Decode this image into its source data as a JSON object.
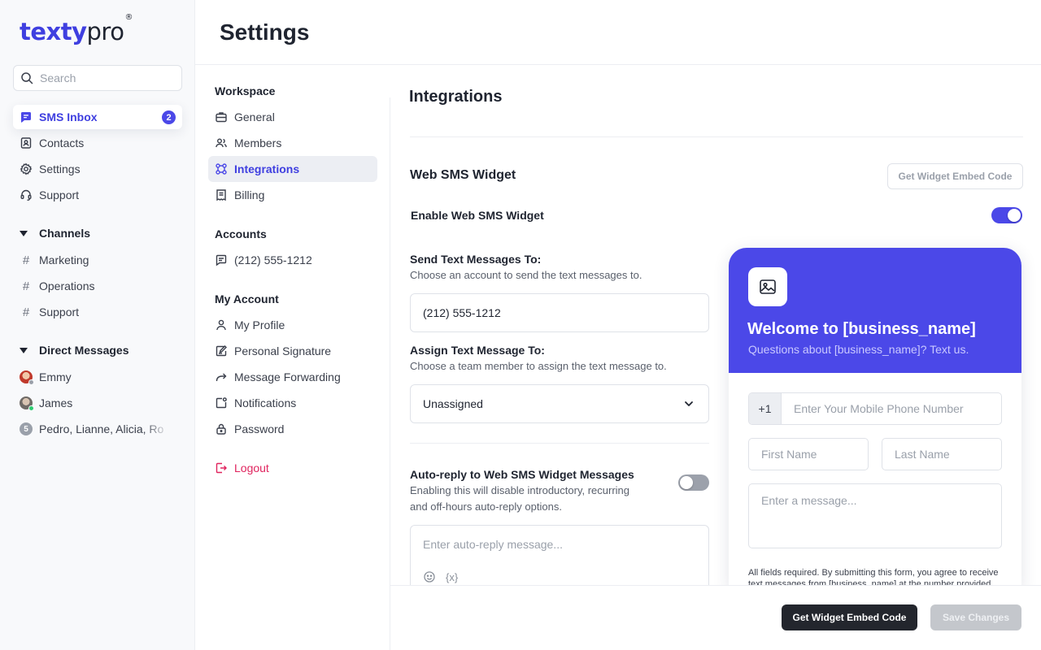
{
  "app": {
    "logo_main": "texty",
    "logo_accent": "pro",
    "logo_mark": "®"
  },
  "search": {
    "placeholder": "Search"
  },
  "sidebar": {
    "items": [
      {
        "label": "SMS Inbox",
        "icon": "chat-icon",
        "badge": "2",
        "active": true
      },
      {
        "label": "Contacts",
        "icon": "contacts-icon"
      },
      {
        "label": "Settings",
        "icon": "gear-icon"
      },
      {
        "label": "Support",
        "icon": "headset-icon"
      }
    ],
    "channels": {
      "heading": "Channels",
      "items": [
        "Marketing",
        "Operations",
        "Support"
      ]
    },
    "direct_messages": {
      "heading": "Direct Messages",
      "items": [
        {
          "label": "Emmy",
          "status": "offline"
        },
        {
          "label": "James",
          "status": "online"
        },
        {
          "label": "Pedro, Lianne, Alicia, Ro",
          "count": "5"
        }
      ]
    }
  },
  "page": {
    "title": "Settings"
  },
  "subnav": {
    "workspace": {
      "heading": "Workspace",
      "items": [
        "General",
        "Members",
        "Integrations",
        "Billing"
      ],
      "active": "Integrations"
    },
    "accounts": {
      "heading": "Accounts",
      "items": [
        "(212) 555-1212"
      ]
    },
    "my_account": {
      "heading": "My Account",
      "items": [
        "My Profile",
        "Personal Signature",
        "Message Forwarding",
        "Notifications",
        "Password"
      ]
    },
    "logout": "Logout"
  },
  "content": {
    "title": "Integrations",
    "widget": {
      "title": "Web SMS Widget",
      "embed_button": "Get Widget Embed Code",
      "enable_label": "Enable Web SMS Widget",
      "enabled": true,
      "send_to_label": "Send Text Messages To:",
      "send_to_help": "Choose an account to send the text messages to.",
      "send_to_value": "(212) 555-1212",
      "assign_label": "Assign Text Message To:",
      "assign_help": "Choose a team member to assign the text message to.",
      "assign_value": "Unassigned",
      "autoreply_label": "Auto-reply to Web SMS Widget Messages",
      "autoreply_help_1": "Enabling this will disable introductory, recurring",
      "autoreply_help_2": "and off-hours auto-reply options.",
      "autoreply_enabled": false,
      "autoreply_placeholder": "Enter auto-reply message...",
      "variable_token": "{x}"
    },
    "preview": {
      "title": "Welcome to [business_name]",
      "subtitle": "Questions about [business_name]? Text us.",
      "country_code": "+1",
      "phone_placeholder": "Enter Your Mobile Phone Number",
      "first_name_placeholder": "First Name",
      "last_name_placeholder": "Last Name",
      "message_placeholder": "Enter a message...",
      "legal_text": "All fields required. By submitting this form, you agree to receive text messages from [business_name] at the number provided."
    }
  },
  "footer": {
    "embed_button": "Get Widget Embed Code",
    "save_button": "Save Changes"
  },
  "colors": {
    "accent": "#4b48e8",
    "logout": "#e0245e",
    "dark_button": "#23262d"
  }
}
